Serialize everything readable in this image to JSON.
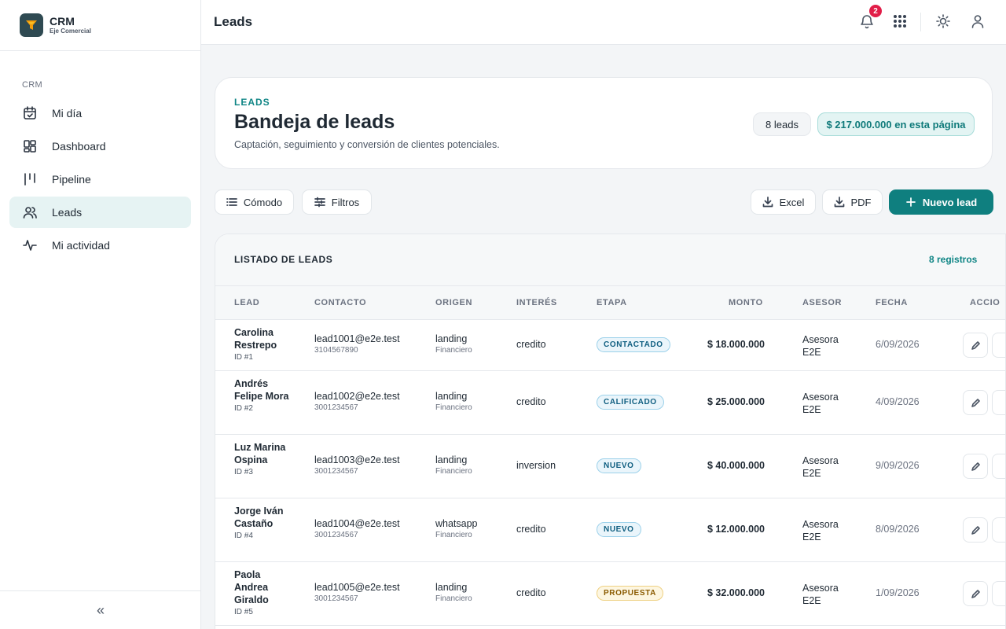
{
  "brand": {
    "name": "CRM",
    "subtitle": "Eje Comercial"
  },
  "sidebar": {
    "section": "CRM",
    "items": [
      {
        "label": "Mi día",
        "icon": "calendar-check-icon"
      },
      {
        "label": "Dashboard",
        "icon": "dashboard-icon"
      },
      {
        "label": "Pipeline",
        "icon": "pipeline-icon"
      },
      {
        "label": "Leads",
        "icon": "users-icon",
        "active": true
      },
      {
        "label": "Mi actividad",
        "icon": "activity-icon"
      }
    ],
    "collapse_label": "«"
  },
  "topbar": {
    "title": "Leads",
    "notifications_count": "2"
  },
  "hero": {
    "eyebrow": "LEADS",
    "title": "Bandeja de leads",
    "description": "Captación, seguimiento y conversión de clientes potenciales.",
    "count_pill": "8 leads",
    "amount_pill": "$ 217.000.000 en esta página"
  },
  "toolbar": {
    "comfort_label": "Cómodo",
    "filters_label": "Filtros",
    "excel_label": "Excel",
    "pdf_label": "PDF",
    "new_label": "Nuevo lead"
  },
  "table": {
    "title": "LISTADO DE LEADS",
    "records": "8 registros",
    "columns": [
      "LEAD",
      "CONTACTO",
      "ORIGEN",
      "INTERÉS",
      "ETAPA",
      "MONTO",
      "ASESOR",
      "FECHA",
      "ACCIO"
    ],
    "rows": [
      {
        "name": "Carolina Restrepo",
        "id": "ID #1",
        "email": "lead1001@e2e.test",
        "phone": "3104567890",
        "origin": "landing",
        "origin_sub": "Financiero",
        "interest": "credito",
        "stage": "CONTACTADO",
        "stage_color": "#0f5e80",
        "amount": "$ 18.000.000",
        "advisor": "Asesora E2E",
        "date": "6/09/2026"
      },
      {
        "name": "Andrés Felipe Mora",
        "id": "ID #2",
        "email": "lead1002@e2e.test",
        "phone": "3001234567",
        "origin": "landing",
        "origin_sub": "Financiero",
        "interest": "credito",
        "stage": "CALIFICADO",
        "stage_color": "#0f5e80",
        "amount": "$ 25.000.000",
        "advisor": "Asesora E2E",
        "date": "4/09/2026"
      },
      {
        "name": "Luz Marina Ospina",
        "id": "ID #3",
        "email": "lead1003@e2e.test",
        "phone": "3001234567",
        "origin": "landing",
        "origin_sub": "Financiero",
        "interest": "inversion",
        "stage": "NUEVO",
        "stage_color": "#0f5e80",
        "amount": "$ 40.000.000",
        "advisor": "Asesora E2E",
        "date": "9/09/2026"
      },
      {
        "name": "Jorge Iván Castaño",
        "id": "ID #4",
        "email": "lead1004@e2e.test",
        "phone": "3001234567",
        "origin": "whatsapp",
        "origin_sub": "Financiero",
        "interest": "credito",
        "stage": "NUEVO",
        "stage_color": "#0f5e80",
        "amount": "$ 12.000.000",
        "advisor": "Asesora E2E",
        "date": "8/09/2026"
      },
      {
        "name": "Paola Andrea Giraldo",
        "id": "ID #5",
        "email": "lead1005@e2e.test",
        "phone": "3001234567",
        "origin": "landing",
        "origin_sub": "Financiero",
        "interest": "credito",
        "stage": "PROPUESTA",
        "stage_color": "#8a5a00",
        "amount": "$ 32.000.000",
        "advisor": "Asesora E2E",
        "date": "1/09/2026"
      }
    ]
  }
}
